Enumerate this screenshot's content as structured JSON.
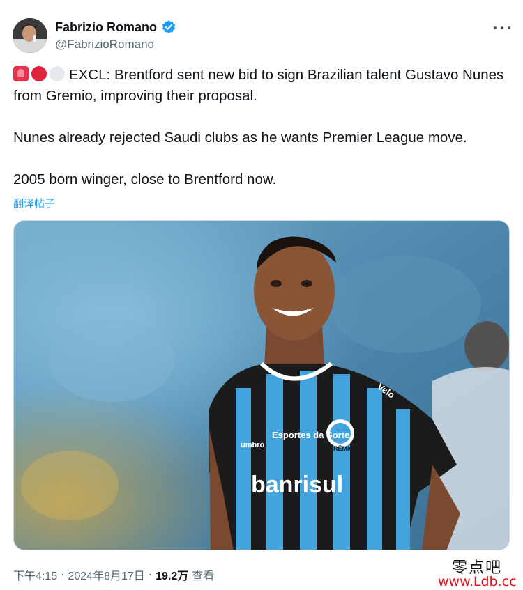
{
  "author": {
    "display_name": "Fabrizio Romano",
    "handle": "@FabrizioRomano",
    "verified": true,
    "avatar_icon": "profile-photo"
  },
  "tweet": {
    "emojis": [
      "rotating-light-icon",
      "red-circle-icon",
      "white-circle-icon"
    ],
    "line1": "EXCL: Brentford sent new bid to sign Brazilian talent Gustavo Nunes from Gremio, improving their proposal.",
    "line2": "Nunes already rejected Saudi clubs as he wants Premier League move.",
    "line3": "2005 born winger, close to Brentford now.",
    "translate_label": "翻译帖子"
  },
  "media": {
    "description": "",
    "jersey_brand": "banrisul",
    "jersey_sponsor": "Esportes da Sorte",
    "jersey_club": "GRÊMIO",
    "jersey_kit": "umbro",
    "jersey_sleeve": "Velo"
  },
  "footer": {
    "time": "下午4:15",
    "date": "2024年8月17日",
    "views_count": "19.2万",
    "views_label": "查看"
  },
  "watermark": {
    "text_cn": "零点吧",
    "url": "www.Ldb.cc"
  },
  "colors": {
    "accent": "#1d9bf0",
    "text_primary": "#0f1419",
    "text_secondary": "#536471",
    "watermark_url": "#e4101b"
  }
}
